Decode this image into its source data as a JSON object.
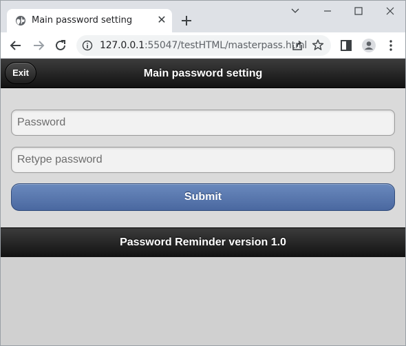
{
  "browser": {
    "tab": {
      "title": "Main password setting",
      "favicon": "globe-icon",
      "close_glyph": "✕"
    },
    "address_bar": {
      "url_host": "127.0.0.1",
      "url_rest": ":55047/testHTML/masterpass.html"
    },
    "window_controls": [
      "chevron-down-icon",
      "minimize-icon",
      "maximize-icon",
      "close-icon"
    ]
  },
  "page": {
    "header": {
      "title": "Main password setting",
      "exit_label": "Exit"
    },
    "form": {
      "password_placeholder": "Password",
      "retype_placeholder": "Retype password",
      "submit_label": "Submit"
    },
    "footer": {
      "text": "Password Reminder version 1.0"
    }
  },
  "colors": {
    "header_bg": "#1e1e1e",
    "submit_bg": "#5a78ae",
    "content_bg": "#dadada"
  }
}
